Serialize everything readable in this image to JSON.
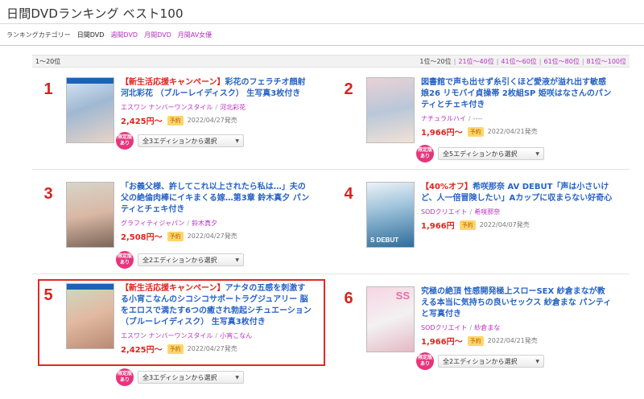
{
  "page_title": "日間DVDランキング ベスト100",
  "category_bar": {
    "label": "ランキングカテゴリー",
    "items": [
      "日間DVD",
      "週間DVD",
      "月間DVD",
      "月間AV女優"
    ],
    "active_index": 0
  },
  "range": {
    "current": "1〜20位",
    "pages": [
      "1位〜20位",
      "21位〜40位",
      "41位〜60位",
      "61位〜80位",
      "81位〜100位"
    ]
  },
  "items": [
    {
      "rank": "1",
      "campaign": "【新生活応援キャンペーン】",
      "title": "彩花のフェラチオ顔射 河北彩花 （ブルーレイディスク） 生写真3枚付き",
      "maker": "エスワン ナンバーワンスタイル",
      "actress": "河北彩花",
      "price": "2,425円〜",
      "badge": "予約",
      "date": "2022/04/27発売",
      "ltd": "限定版あり",
      "edition": "全3エディションから選択"
    },
    {
      "rank": "2",
      "campaign": "",
      "title": "図書館で声も出せず糸引くほど愛液が溢れ出す敏感娘26 リモバイ貞操帯 2枚組SP 姫咲はなさんのパンティとチェキ付き",
      "maker": "ナチュラルハイ",
      "actress": "----",
      "price": "1,966円〜",
      "badge": "予約",
      "date": "2022/04/21発売",
      "ltd": "限定版あり",
      "edition": "全5エディションから選択"
    },
    {
      "rank": "3",
      "campaign": "",
      "title": "「お義父様、許してこれ以上されたら私は…」夫の父の絶倫肉棒にイキまくる嫁…第3章 鈴木真夕 パンティとチェキ付き",
      "maker": "グラフィティジャパン",
      "actress": "鈴木真夕",
      "price": "2,508円〜",
      "badge": "予約",
      "date": "2022/04/27発売",
      "ltd": "限定版あり",
      "edition": "全2エディションから選択"
    },
    {
      "rank": "4",
      "campaign": "【40%オフ】",
      "title": "希咲那奈 AV DEBUT「声は小さいけど、人一倍冒険したい」Aカップに収まらない好奇心",
      "maker": "SODクリエイト",
      "actress": "希咲那奈",
      "price": "1,966円",
      "badge": "予約",
      "date": "2022/04/07発売",
      "ltd": "",
      "edition": ""
    },
    {
      "rank": "5",
      "campaign": "【新生活応援キャンペーン】",
      "title": "アナタの五感を刺激する小宵こなんのシコシコサポートラグジュアリー 脳をエロスで満たす6つの癒され勃起シチュエーション （ブルーレイディスク） 生写真3枚付き",
      "maker": "エスワン ナンバーワンスタイル",
      "actress": "小宵こなん",
      "price": "2,425円〜",
      "badge": "予約",
      "date": "2022/04/27発売",
      "ltd": "限定版あり",
      "edition": "全3エディションから選択"
    },
    {
      "rank": "6",
      "campaign": "",
      "title": "究極の絶頂 性感開発極上スローSEX 紗倉まなが教える本当に気持ちの良いセックス 紗倉まな パンティと写真付き",
      "maker": "SODクリエイト",
      "actress": "紗倉まな",
      "price": "1,966円〜",
      "badge": "予約",
      "date": "2022/04/21発売",
      "ltd": "限定版あり",
      "edition": "全2エディションから選択"
    }
  ],
  "cover_labels": {
    "item4": "S DEBUT",
    "item6": "SS"
  },
  "colors": {
    "rank_red": "#d4231f",
    "link_blue": "#2663c6",
    "link_purple": "#b72fc2",
    "limited_pink": "#e6357c",
    "highlight_red": "#e02a23"
  }
}
